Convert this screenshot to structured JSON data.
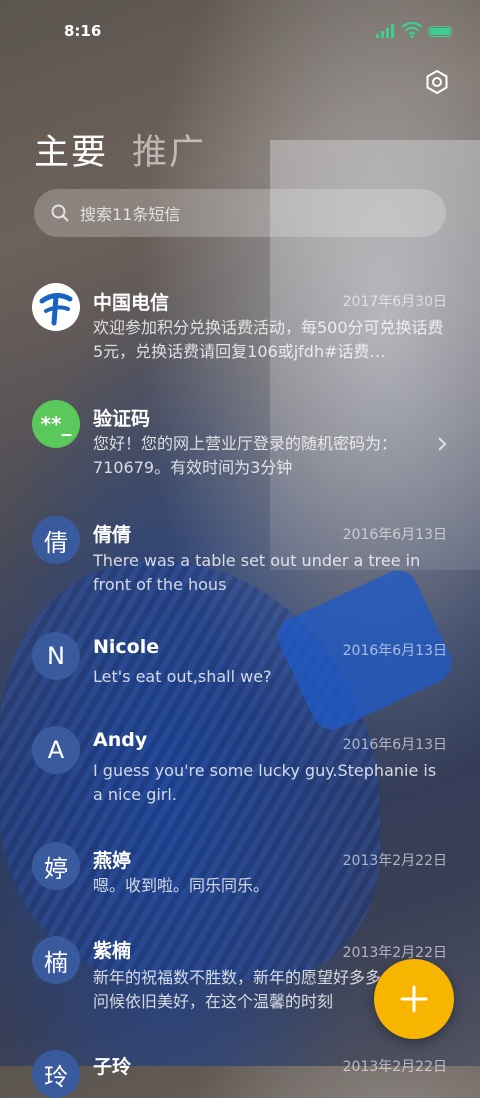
{
  "status_bar": {
    "time": "8:16"
  },
  "tabs": [
    {
      "label": "主要",
      "active": true
    },
    {
      "label": "推广",
      "active": false
    }
  ],
  "search": {
    "placeholder": "搜索11条短信"
  },
  "messages": [
    {
      "avatar_text": "",
      "avatar_icon": "china-telecom-logo-icon",
      "name": "中国电信",
      "date": "2017年6月30日",
      "preview": "欢迎参加积分兑换话费活动，每500分可兑换话费5元，兑换话费请回复106或jfdh#话费…"
    },
    {
      "avatar_text": "**_",
      "name": "验证码",
      "date": "",
      "preview": "您好！您的网上营业厅登录的随机密码为：710679。有效时间为3分钟"
    },
    {
      "avatar_text": "倩",
      "name": "倩倩",
      "date": "2016年6月13日",
      "preview": "There was a table set out under a tree in front of the hous"
    },
    {
      "avatar_text": "N",
      "name": "Nicole",
      "date": "2016年6月13日",
      "preview": "Let's eat out,shall we?"
    },
    {
      "avatar_text": "A",
      "name": "Andy",
      "date": "2016年6月13日",
      "preview": "I guess you're some lucky guy.Stephanie is a nice girl."
    },
    {
      "avatar_text": "婷",
      "name": "燕婷",
      "date": "2013年2月22日",
      "preview": "嗯。收到啦。同乐同乐。"
    },
    {
      "avatar_text": "楠",
      "name": "紫楠",
      "date": "2013年2月22日",
      "preview": "新年的祝福数不胜数，新年的愿望好多多，新年的问候依旧美好，在这个温馨的时刻"
    },
    {
      "avatar_text": "玲",
      "name": "子玲",
      "date": "2013年2月22日",
      "preview": ""
    }
  ],
  "colors": {
    "accent": "#f7b500",
    "verify_green": "#5ac85a",
    "avatar_blue": "#3a5a9e",
    "battery": "#3ecf8e"
  }
}
